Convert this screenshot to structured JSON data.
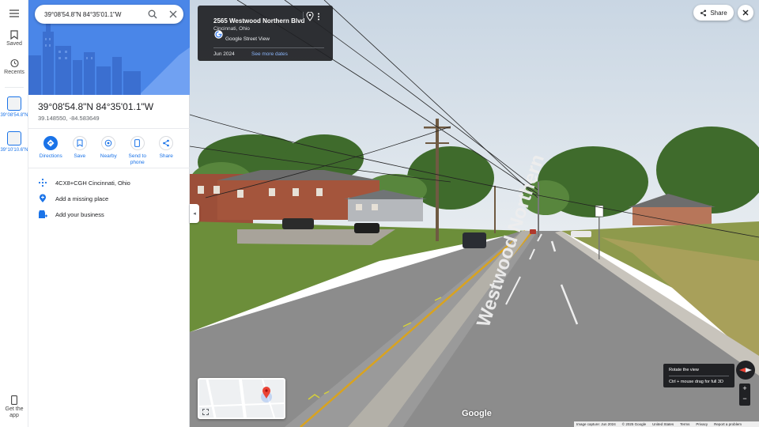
{
  "rail": {
    "saved_label": "Saved",
    "recents_label": "Recents",
    "recent_1": "39°08'54.8\"N",
    "recent_2": "39°10'10.6\"N",
    "get_app_label": "Get the app"
  },
  "search": {
    "value": "39°08'54.8\"N 84°35'01.1\"W"
  },
  "place": {
    "title": "39°08'54.8\"N 84°35'01.1\"W",
    "coords": "39.148550, -84.583649",
    "plus_code": "4CX8+CGH Cincinnati, Ohio",
    "missing_place": "Add a missing place",
    "add_business": "Add your business"
  },
  "actions": {
    "directions": "Directions",
    "save": "Save",
    "nearby": "Nearby",
    "send_to_phone": "Send to phone",
    "share": "Share"
  },
  "streetview": {
    "address": "2565 Westwood Northern Blvd",
    "city": "Cincinnati, Ohio",
    "source": "Google Street View",
    "date": "Jun 2024",
    "more_dates": "See more dates",
    "share_label": "Share",
    "rotate_tip": "Rotate the view",
    "drag_tip": "Ctrl + mouse drag for full 3D",
    "google_logo": "Google",
    "road_text": "Westwood Northern"
  },
  "footer": {
    "capture": "Image capture: Jun 2024",
    "copyright": "© 2025 Google",
    "region": "United States",
    "terms": "Terms",
    "privacy": "Privacy",
    "report": "Report a problem"
  },
  "colors": {
    "accent": "#1a73e8",
    "hero": "#4a86e8",
    "pin": "#ea4335"
  }
}
